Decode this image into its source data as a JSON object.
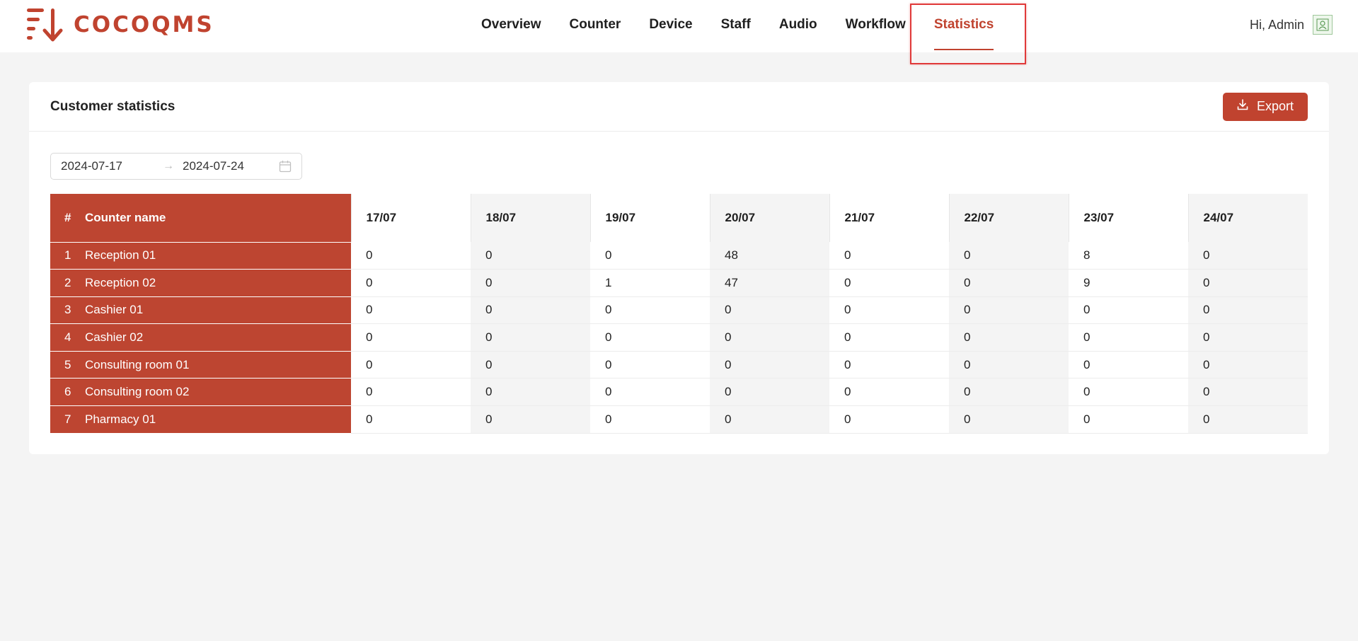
{
  "app": {
    "brand": "COCOQMS",
    "brand_color": "#c0432f"
  },
  "nav": {
    "items": [
      {
        "label": "Overview"
      },
      {
        "label": "Counter"
      },
      {
        "label": "Device"
      },
      {
        "label": "Staff"
      },
      {
        "label": "Audio"
      },
      {
        "label": "Workflow"
      },
      {
        "label": "Statistics",
        "active": true
      }
    ]
  },
  "user": {
    "greeting": "Hi, Admin",
    "avatar_icon": "avatar-icon"
  },
  "card": {
    "title": "Customer statistics",
    "export_label": "Export",
    "export_icon": "download-icon"
  },
  "date_range": {
    "start": "2024-07-17",
    "separator": "→",
    "end": "2024-07-24",
    "icon": "calendar-icon"
  },
  "table": {
    "headers": {
      "num": "#",
      "name": "Counter name",
      "days": [
        "17/07",
        "18/07",
        "19/07",
        "20/07",
        "21/07",
        "22/07",
        "23/07",
        "24/07"
      ]
    },
    "rows": [
      {
        "num": "1",
        "name": "Reception 01",
        "values": [
          "0",
          "0",
          "0",
          "48",
          "0",
          "0",
          "8",
          "0"
        ]
      },
      {
        "num": "2",
        "name": "Reception 02",
        "values": [
          "0",
          "0",
          "1",
          "47",
          "0",
          "0",
          "9",
          "0"
        ]
      },
      {
        "num": "3",
        "name": "Cashier 01",
        "values": [
          "0",
          "0",
          "0",
          "0",
          "0",
          "0",
          "0",
          "0"
        ]
      },
      {
        "num": "4",
        "name": "Cashier 02",
        "values": [
          "0",
          "0",
          "0",
          "0",
          "0",
          "0",
          "0",
          "0"
        ]
      },
      {
        "num": "5",
        "name": "Consulting room 01",
        "values": [
          "0",
          "0",
          "0",
          "0",
          "0",
          "0",
          "0",
          "0"
        ]
      },
      {
        "num": "6",
        "name": "Consulting room 02",
        "values": [
          "0",
          "0",
          "0",
          "0",
          "0",
          "0",
          "0",
          "0"
        ]
      },
      {
        "num": "7",
        "name": "Pharmacy 01",
        "values": [
          "0",
          "0",
          "0",
          "0",
          "0",
          "0",
          "0",
          "0"
        ]
      }
    ]
  }
}
